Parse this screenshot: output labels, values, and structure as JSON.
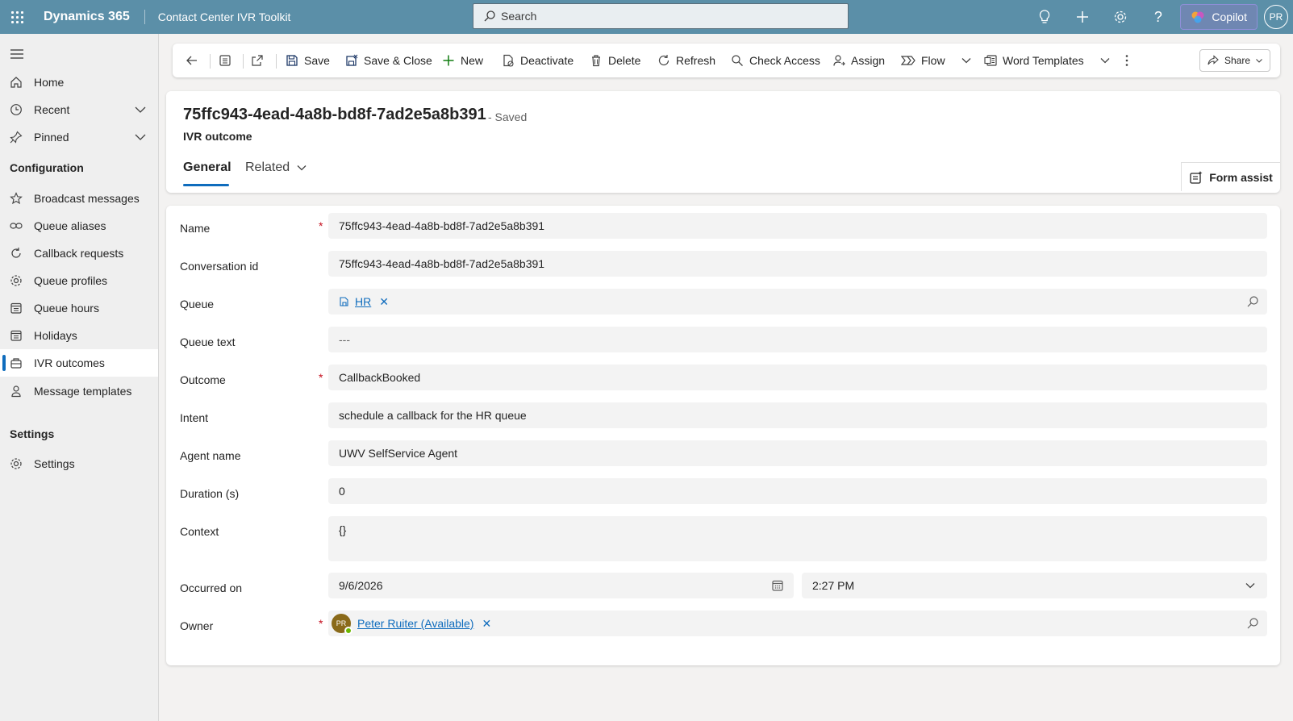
{
  "topbar": {
    "brand": "Dynamics 365",
    "app_name": "Contact Center IVR Toolkit",
    "search_placeholder": "Search",
    "copilot_label": "Copilot",
    "user_initials": "PR"
  },
  "sidebar": {
    "items": [
      {
        "label": "Home",
        "icon": "home-icon"
      },
      {
        "label": "Recent",
        "icon": "clock-icon"
      },
      {
        "label": "Pinned",
        "icon": "pin-icon"
      }
    ],
    "configuration_heading": "Configuration",
    "config_items": [
      {
        "label": "Broadcast messages",
        "icon": "star-icon"
      },
      {
        "label": "Queue aliases",
        "icon": "link-icon"
      },
      {
        "label": "Callback requests",
        "icon": "callback-icon"
      },
      {
        "label": "Queue profiles",
        "icon": "gear-icon"
      },
      {
        "label": "Queue hours",
        "icon": "calendar-icon"
      },
      {
        "label": "Holidays",
        "icon": "calendar-icon"
      },
      {
        "label": "IVR outcomes",
        "icon": "outcome-icon"
      },
      {
        "label": "Message templates",
        "icon": "person-icon"
      }
    ],
    "active_item": "IVR outcomes",
    "settings_heading": "Settings",
    "settings_items": [
      {
        "label": "Settings",
        "icon": "gear-icon"
      }
    ]
  },
  "commandbar": {
    "save": "Save",
    "save_close": "Save & Close",
    "new": "New",
    "deactivate": "Deactivate",
    "delete": "Delete",
    "refresh": "Refresh",
    "check_access": "Check Access",
    "assign": "Assign",
    "flow": "Flow",
    "word_templates": "Word Templates",
    "share": "Share"
  },
  "record": {
    "title": "75ffc943-4ead-4a8b-bd8f-7ad2e5a8b391",
    "saved_status": "- Saved",
    "entity": "IVR outcome",
    "tabs": [
      "General",
      "Related"
    ],
    "form_assist": "Form assist"
  },
  "form": {
    "name_label": "Name",
    "name_value": "75ffc943-4ead-4a8b-bd8f-7ad2e5a8b391",
    "conversation_label": "Conversation id",
    "conversation_value": "75ffc943-4ead-4a8b-bd8f-7ad2e5a8b391",
    "queue_label": "Queue",
    "queue_value": "HR",
    "queue_text_label": "Queue text",
    "queue_text_value": "---",
    "outcome_label": "Outcome",
    "outcome_value": "CallbackBooked",
    "intent_label": "Intent",
    "intent_value": "schedule a callback for the HR queue",
    "agent_label": "Agent name",
    "agent_value": "UWV SelfService Agent",
    "duration_label": "Duration (s)",
    "duration_value": "0",
    "context_label": "Context",
    "context_value": "{}",
    "occurred_label": "Occurred on",
    "occurred_date": "9/6/2026",
    "occurred_time": "2:27 PM",
    "owner_label": "Owner",
    "owner_initials": "PR",
    "owner_value": "Peter Ruiter (Available)",
    "required_mark": "*"
  },
  "colors": {
    "topbar_bg": "#5b8fa8",
    "accent": "#0f6cbd",
    "required": "#c50f1f",
    "presence_available": "#6bb700"
  }
}
